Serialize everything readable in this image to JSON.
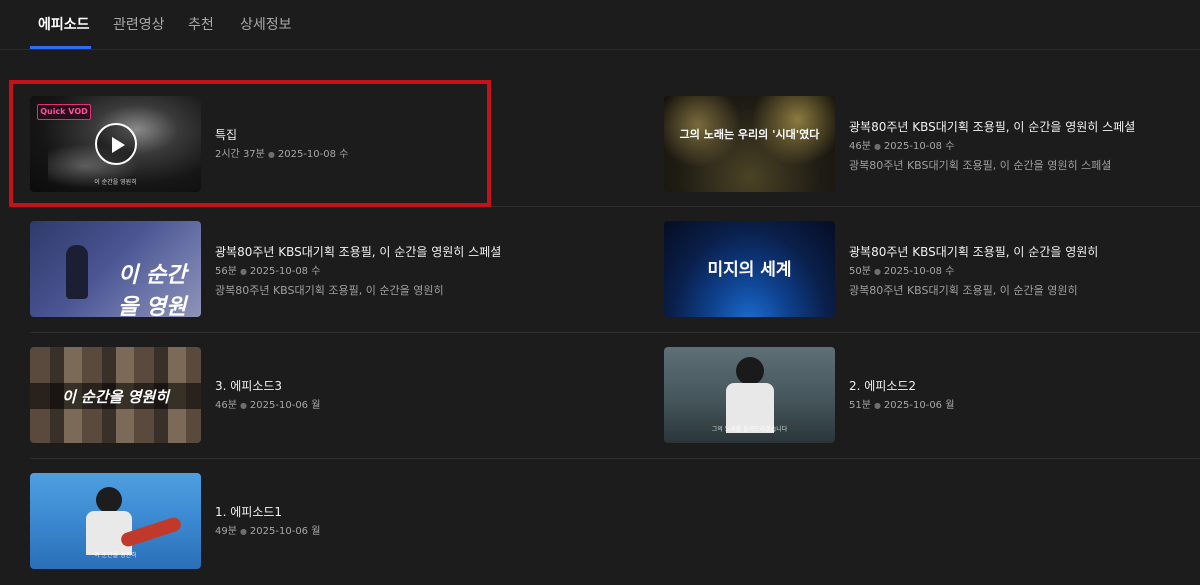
{
  "tabs": [
    {
      "label": "에피소드",
      "active": true
    },
    {
      "label": "관련영상",
      "active": false
    },
    {
      "label": "추천",
      "active": false
    },
    {
      "label": "상세정보",
      "active": false
    }
  ],
  "episodes": [
    {
      "title": "특집",
      "duration": "2시간 37분",
      "date": "2025-10-08 수",
      "description": "",
      "badge": "Quick VOD",
      "thumb_caption": "이 순간을 영원히"
    },
    {
      "title": "광복80주년 KBS대기획 조용필, 이 순간을 영원히 스페셜",
      "duration": "46분",
      "date": "2025-10-08 수",
      "description": "광복80주년 KBS대기획 조용필, 이 순간을 영원히 스페셜",
      "thumb_caption": "그의 노래는 우리의 '시대'였다"
    },
    {
      "title": "광복80주년 KBS대기획 조용필, 이 순간을 영원히 스페셜",
      "duration": "56분",
      "date": "2025-10-08 수",
      "description": "광복80주년 KBS대기획 조용필, 이 순간을 영원히",
      "thumb_caption": "이 순간을 영원히"
    },
    {
      "title": "광복80주년 KBS대기획 조용필, 이 순간을 영원히",
      "duration": "50분",
      "date": "2025-10-08 수",
      "description": "광복80주년 KBS대기획 조용필, 이 순간을 영원히",
      "thumb_caption": "미지의 세계"
    },
    {
      "title": "3. 에피소드3",
      "duration": "46분",
      "date": "2025-10-06 월",
      "description": "",
      "thumb_caption": "이 순간을 영원히"
    },
    {
      "title": "2. 에피소드2",
      "duration": "51분",
      "date": "2025-10-06 월",
      "description": "",
      "thumb_caption": "그의 노래를 들려드리겠습니다"
    },
    {
      "title": "1. 에피소드1",
      "duration": "49분",
      "date": "2025-10-06 월",
      "description": "",
      "thumb_caption": "이 순간을 영원히"
    }
  ],
  "colors": {
    "background": "#1c1c1c",
    "active_tab_underline": "#2f6df6",
    "highlight_box": "#c4121b",
    "quick_vod_badge": "#ff4fa0"
  },
  "icons": {
    "play": "play-icon"
  }
}
